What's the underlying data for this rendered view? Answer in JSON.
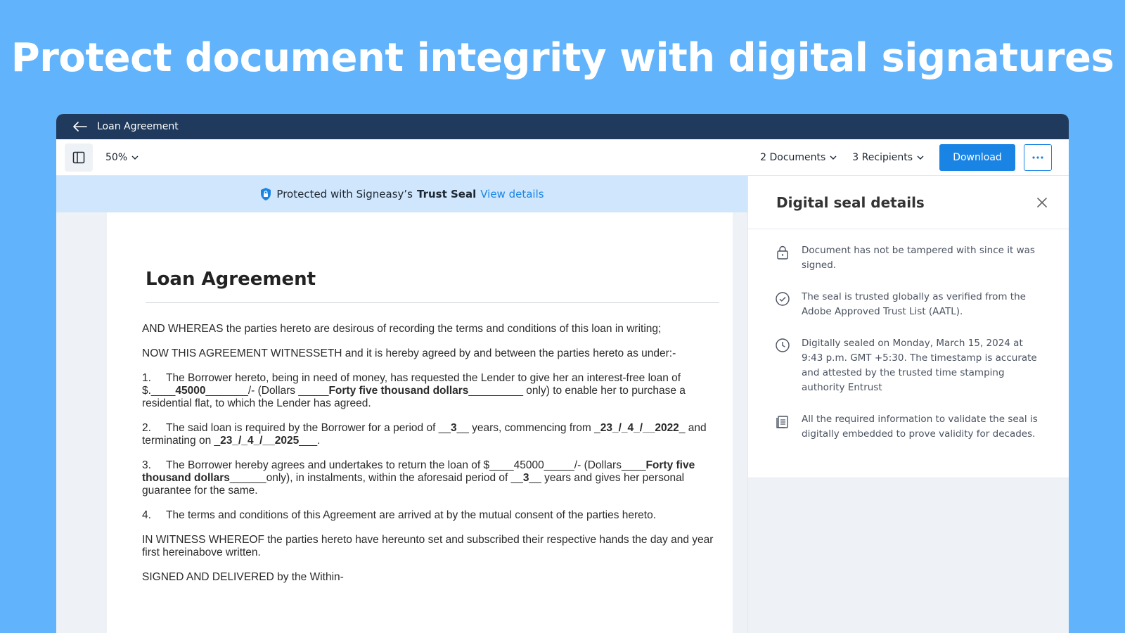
{
  "hero": {
    "title": "Protect document integrity with digital signatures"
  },
  "titlebar": {
    "title": "Loan Agreement"
  },
  "toolbar": {
    "zoom": "50%",
    "documents": "2 Documents",
    "recipients": "3 Recipients",
    "download_label": "Download"
  },
  "banner": {
    "prefix": "Protected with Signeasy’s",
    "strong": "Trust Seal",
    "link": "View details"
  },
  "document": {
    "title": "Loan Agreement",
    "p1": "AND WHEREAS the parties hereto are desirous of recording the terms and conditions of this loan in writing;",
    "p2": "NOW THIS AGREEMENT WITNESSETH and it is hereby agreed by and between the parties hereto as under:-",
    "items": [
      {
        "num": "1.",
        "a": "The Borrower hereto, being in need of money, has requested the Lender to give her an interest-free loan of $.____",
        "b1": "45000",
        "c": "_______/- (Dollars _____",
        "b2": "Forty five thousand dollars",
        "d": "_________ only) to enable her to purchase a residential flat, to which the Lender has agreed."
      },
      {
        "num": "2.",
        "a": "The said loan is required by the Borrower for a period of __",
        "b1": "3",
        "c": "__ years, commencing from _",
        "b2": "23_/_4_/__2022",
        "d": "_ and terminating on _",
        "b3": "23_/_4_/__2025",
        "e": "___."
      },
      {
        "num": "3.",
        "a": "The Borrower hereby agrees and undertakes to return the loan of $____45000_____/- (Dollars____",
        "b1": "Forty five thousand dollars",
        "c": "______only), in instalments, within the aforesaid period of __",
        "b2": "3",
        "d": "__ years and gives her personal guarantee for the same."
      },
      {
        "num": "4.",
        "a": "The terms and conditions of this Agreement are arrived at by the mutual consent of the parties hereto."
      }
    ],
    "p3": "IN WITNESS WHEREOF the parties hereto have hereunto set and subscribed their respective hands the day and year first hereinabove written.",
    "p4": "SIGNED AND DELIVERED by the Within-"
  },
  "panel": {
    "title": "Digital seal details",
    "items": [
      {
        "icon": "lock-icon",
        "text": "Document has not be tampered with since it was signed."
      },
      {
        "icon": "check-circle-icon",
        "text": "The seal is trusted globally as verified from the Adobe Approved Trust List (AATL)."
      },
      {
        "icon": "clock-icon",
        "text": "Digitally sealed on Monday, March 15, 2024 at 9:43 p.m. GMT +5:30. The timestamp is accurate and attested by the trusted time stamping authority Entrust"
      },
      {
        "icon": "document-copy-icon",
        "text": "All the required information to validate the seal is digitally embedded to prove validity for decades."
      }
    ]
  },
  "colors": {
    "background": "#61b3fb",
    "titlebar": "#1f3a5c",
    "accent": "#1a84e5",
    "banner": "#cfe6fc"
  }
}
